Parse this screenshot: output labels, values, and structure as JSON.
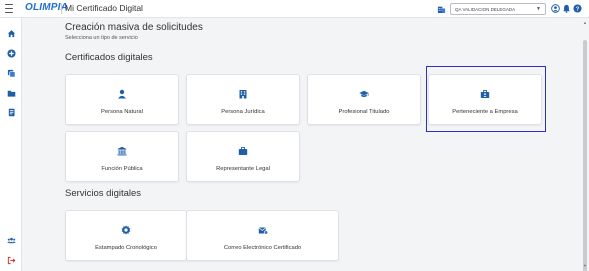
{
  "header": {
    "brand": "OLIMPIA",
    "app_title": "Mi Certificado Digital",
    "org_select_value": "QA VALIDACION DELEGADA",
    "icons": [
      "hamburger-icon",
      "building-icon",
      "chevron-down-icon",
      "user-circle-icon",
      "bell-icon",
      "help-icon"
    ]
  },
  "sidebar": {
    "icons": [
      "home-icon",
      "plus-circle-icon",
      "copy-icon",
      "folder-icon",
      "document-icon",
      "users-icon",
      "logout-icon"
    ]
  },
  "page": {
    "title": "Creación masiva de solicitudes",
    "subtitle": "Selecciona un tipo de servicio"
  },
  "sections": {
    "certificados": {
      "title": "Certificados digitales",
      "cards": [
        {
          "label": "Persona Natural",
          "icon": "person-icon"
        },
        {
          "label": "Persona Jurídica",
          "icon": "building-icon"
        },
        {
          "label": "Profesional Titulado",
          "icon": "graduation-cap-icon"
        },
        {
          "label": "Perteneciente a Empresa",
          "icon": "briefcase-user-icon"
        },
        {
          "label": "Función Pública",
          "icon": "government-building-icon"
        },
        {
          "label": "Representante Legal",
          "icon": "briefcase-icon"
        }
      ]
    },
    "servicios": {
      "title": "Servicios digitales",
      "cards": [
        {
          "label": "Estampado Cronológico",
          "icon": "gear-seal-icon"
        },
        {
          "label": "Correo Electrónico Certificado",
          "icon": "certified-mail-icon"
        }
      ]
    }
  },
  "colors": {
    "brand": "#1f6fd6",
    "icon": "#1f5fa8",
    "highlight": "#2f2fc8",
    "logout": "#d9342b"
  }
}
